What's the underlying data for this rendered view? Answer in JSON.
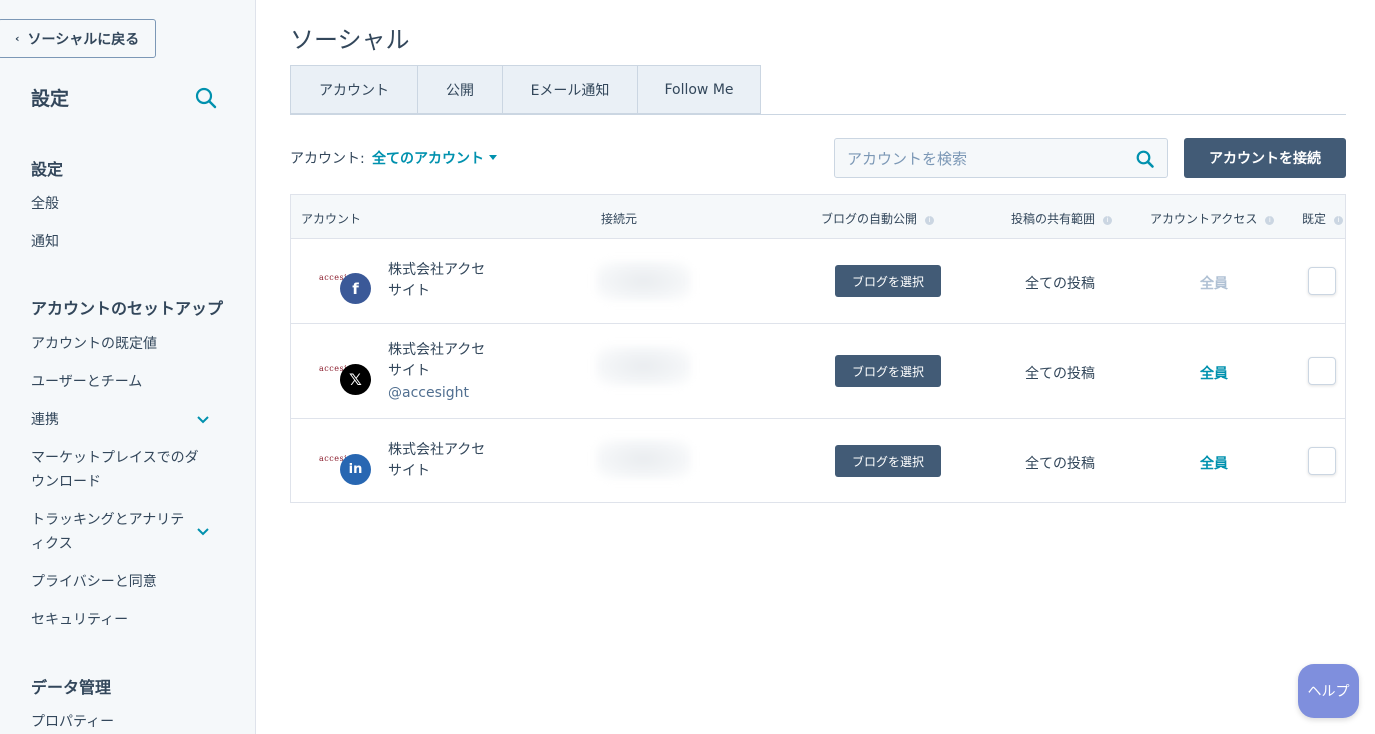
{
  "sidebar": {
    "back_label": "ソーシャルに戻る",
    "title": "設定",
    "sections": [
      {
        "heading": "設定",
        "items": [
          "全般",
          "通知"
        ]
      },
      {
        "heading": "アカウントのセットアップ",
        "items": [
          "アカウントの既定値",
          "ユーザーとチーム",
          "連携",
          "マーケットプレイスでのダウンロード",
          "トラッキングとアナリティクス",
          "プライバシーと同意",
          "セキュリティー"
        ]
      },
      {
        "heading": "データ管理",
        "items": [
          "プロパティー"
        ]
      }
    ]
  },
  "main": {
    "title": "ソーシャル",
    "tabs": [
      {
        "label": "アカウント"
      },
      {
        "label": "公開"
      },
      {
        "label": "Eメール通知"
      },
      {
        "label": "Follow Me"
      }
    ],
    "filter": {
      "label": "アカウント:",
      "value": "全てのアカウント"
    },
    "search": {
      "placeholder": "アカウントを検索"
    },
    "connect_button": "アカウントを接続",
    "table": {
      "headers": [
        "アカウント",
        "接続元",
        "ブログの自動公開",
        "投稿の共有範囲",
        "アカウントアクセス",
        "既定"
      ],
      "rows": [
        {
          "logo": "accesi",
          "network": "facebook",
          "network_icon": "f",
          "name": "株式会社アクセサイト",
          "handle": "",
          "blog_button": "ブログを選択",
          "scope": "全ての投稿",
          "access": "全員",
          "access_color": "#b0c1d4"
        },
        {
          "logo": "accesi",
          "network": "x",
          "network_icon": "𝕏",
          "name": "株式会社アクセサイト",
          "handle": "@accesight",
          "blog_button": "ブログを選択",
          "scope": "全ての投稿",
          "access": "全員",
          "access_color": "#0091ae"
        },
        {
          "logo": "accesi",
          "network": "linkedin",
          "network_icon": "in",
          "name": "株式会社アクセサイト",
          "handle": "",
          "blog_button": "ブログを選択",
          "scope": "全ての投稿",
          "access": "全員",
          "access_color": "#0091ae"
        }
      ]
    }
  },
  "help": {
    "label": "ヘルプ"
  },
  "colors": {
    "primary_button": "#425b76",
    "link": "#0091ae",
    "sidebar_bg": "#f5f8fa",
    "help_bg": "#7f8fdd",
    "facebook": "#3b5998",
    "x": "#000000",
    "linkedin": "#2867b2"
  }
}
